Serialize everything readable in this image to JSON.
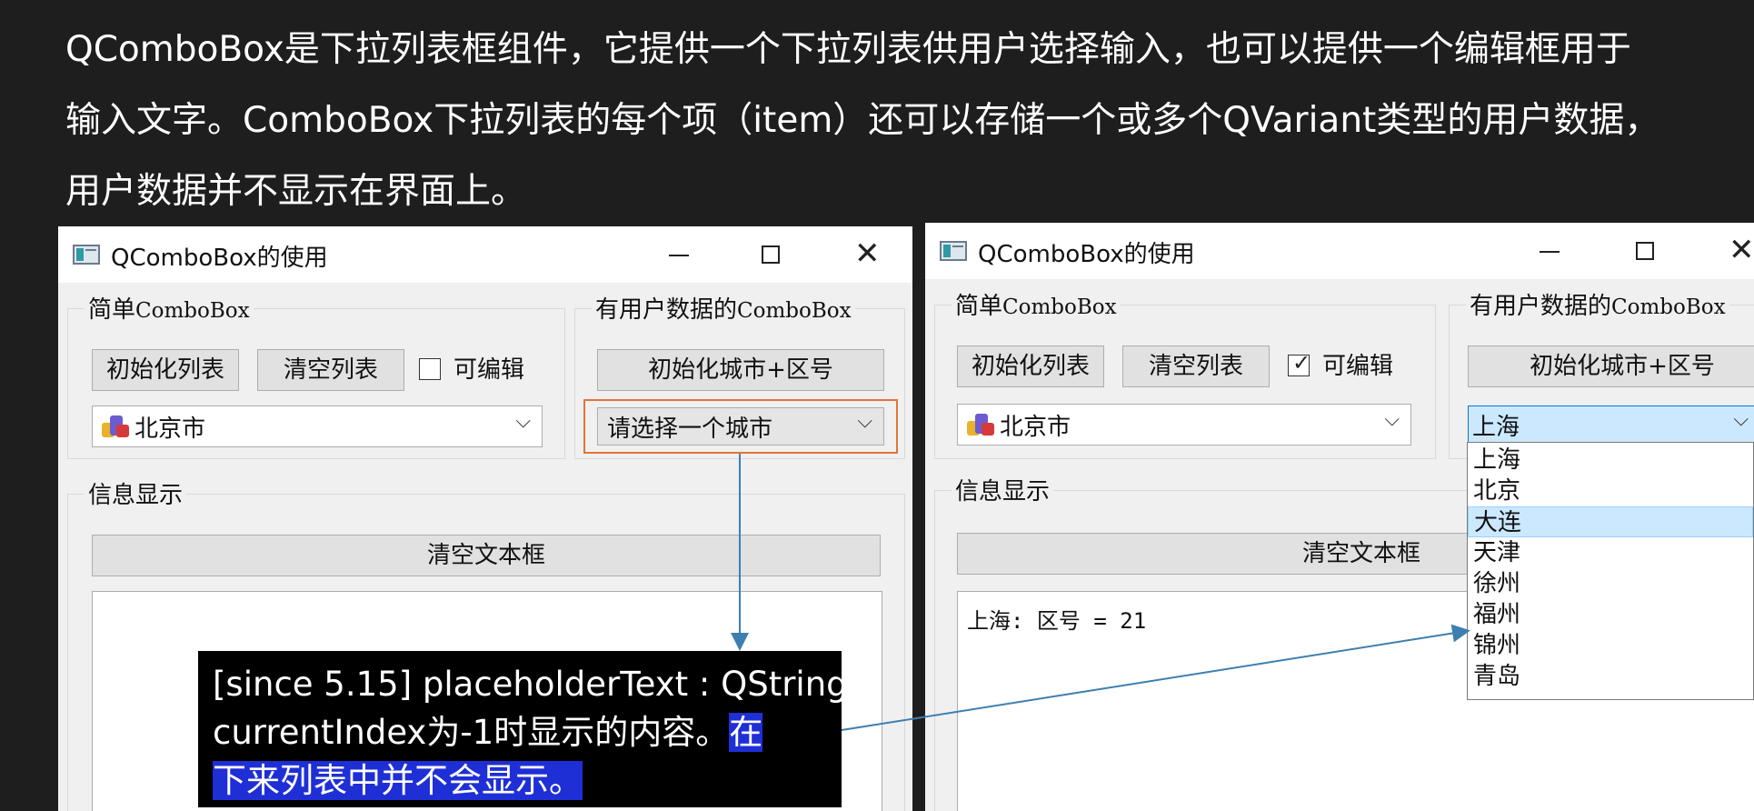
{
  "intro": {
    "line1": "QComboBox是下拉列表框组件，它提供一个下拉列表供用户选择输入，也可以提供一个编辑框用于",
    "line2": "输入文字。ComboBox下拉列表的每个项（item）还可以存储一个或多个QVariant类型的用户数据，",
    "line3": "用户数据并不显示在界面上。"
  },
  "left_window": {
    "title": "QComboBox的使用",
    "simple_group": {
      "title_cn": "简单",
      "title_en": "ComboBox",
      "init_button": "初始化列表",
      "clear_button": "清空列表",
      "editable_label": "可编辑",
      "editable_checked": false,
      "combo_value": "北京市",
      "combo_icon": "city-buildings-icon"
    },
    "user_data_group": {
      "title_cn": "有用户数据的",
      "title_en": "ComboBox",
      "init_button": "初始化城市+区号",
      "placeholder": "请选择一个城市"
    },
    "info_group": {
      "title": "信息显示",
      "clear_text_button": "清空文本框",
      "text": ""
    }
  },
  "right_window": {
    "title": "QComboBox的使用",
    "simple_group": {
      "title_cn": "简单",
      "title_en": "ComboBox",
      "init_button": "初始化列表",
      "clear_button": "清空列表",
      "editable_label": "可编辑",
      "editable_checked": true,
      "check_mark": "✓",
      "combo_value": "北京市",
      "combo_icon": "city-buildings-icon"
    },
    "user_data_group": {
      "title_cn": "有用户数据的",
      "title_en": "ComboBox",
      "init_button": "初始化城市+区号",
      "combo_value": "上海",
      "dropdown_items": [
        "上海",
        "北京",
        "大连",
        "天津",
        "徐州",
        "福州",
        "锦州",
        "青岛"
      ],
      "highlighted_item": "大连"
    },
    "info_group": {
      "title": "信息显示",
      "clear_text_button": "清空文本框",
      "text": "上海: 区号 = 21"
    }
  },
  "window_controls": {
    "minimize": "—",
    "maximize": "☐",
    "close": "✕"
  },
  "tooltip": {
    "line1": "[since 5.15] placeholderText : QString",
    "line2_plain": "currentIndex为-1时显示的内容。",
    "line2_highlight": "在",
    "line3_highlight": "下来列表中并不会显示。"
  },
  "colors": {
    "annotation_arrow": "#3d7fb0",
    "highlight_frame": "#e0743a",
    "tooltip_highlight": "#1f2fd6",
    "dropdown_selection": "#cce8ff"
  }
}
